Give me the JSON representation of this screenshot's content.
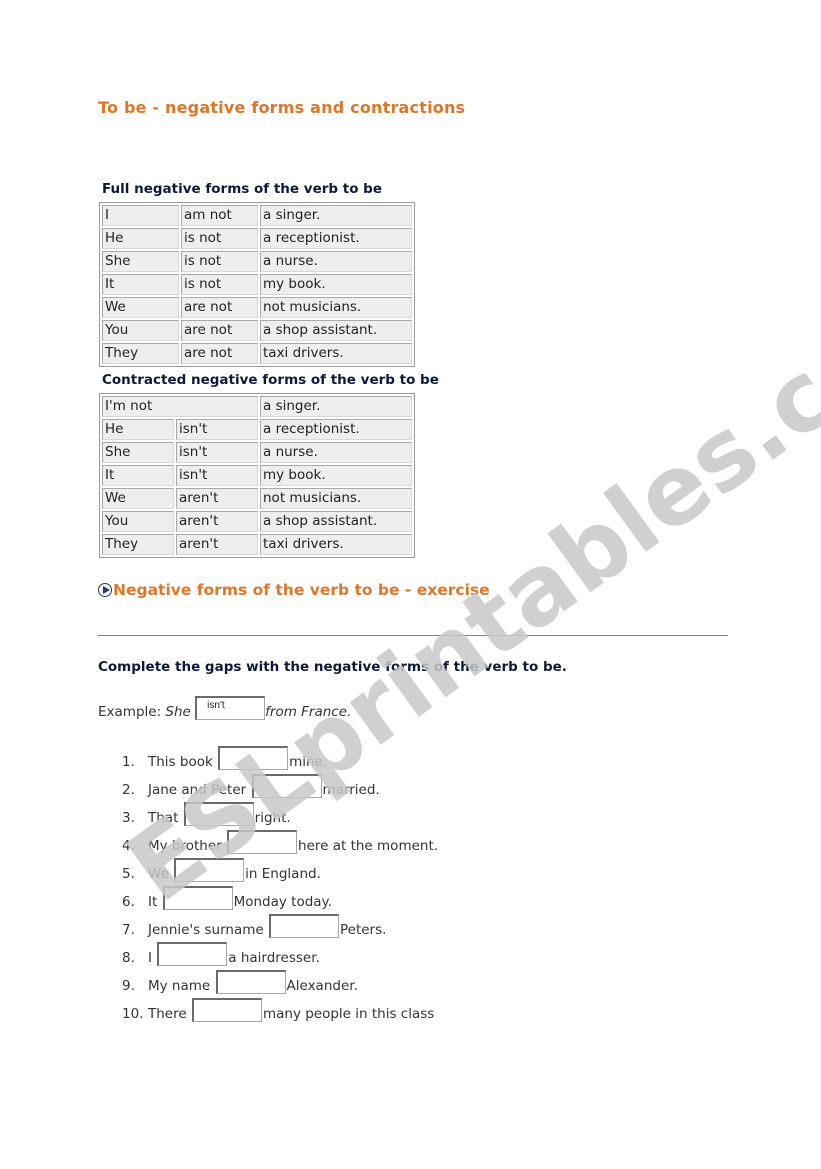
{
  "title": "To be - negative forms and contractions",
  "full_table": {
    "caption": "Full negative forms of the verb to be",
    "rows": [
      [
        "I",
        "am not",
        "a singer."
      ],
      [
        "He",
        "is not",
        "a receptionist."
      ],
      [
        "She",
        "is not",
        "a nurse."
      ],
      [
        "It",
        "is not",
        "my book."
      ],
      [
        "We",
        "are not",
        "not musicians."
      ],
      [
        "You",
        "are not",
        "a shop assistant."
      ],
      [
        "They",
        "are not",
        "taxi drivers."
      ]
    ]
  },
  "contracted_table": {
    "caption": "Contracted negative forms of the verb to be",
    "first_row": [
      "I'm not",
      "a singer."
    ],
    "rows": [
      [
        "He",
        "isn't",
        "a receptionist."
      ],
      [
        "She",
        "isn't",
        "a nurse."
      ],
      [
        "It",
        "isn't",
        "my book."
      ],
      [
        "We",
        "aren't",
        "not musicians."
      ],
      [
        "You",
        "aren't",
        "a shop assistant."
      ],
      [
        "They",
        "aren't",
        "taxi drivers."
      ]
    ]
  },
  "exercise": {
    "icon": "play-circle-icon",
    "title": "Negative forms of the verb to be - exercise",
    "instruction": "Complete the gaps with the negative forms of the verb to be.",
    "example": {
      "label": "Example:",
      "subject": "She",
      "answer": "isn't",
      "rest": "from France."
    },
    "items": [
      {
        "num": "1.",
        "before": "This book",
        "value": "",
        "after": "mine."
      },
      {
        "num": "2.",
        "before": "Jane and Peter",
        "value": "",
        "after": "married."
      },
      {
        "num": "3.",
        "before": "That",
        "value": "",
        "after": "right."
      },
      {
        "num": "4.",
        "before": "My brother",
        "value": "",
        "after": "here at the moment."
      },
      {
        "num": "5.",
        "before": "We",
        "value": "",
        "after": "in England."
      },
      {
        "num": "6.",
        "before": "It",
        "value": "",
        "after": "Monday today."
      },
      {
        "num": "7.",
        "before": "Jennie's surname",
        "value": "",
        "after": "Peters."
      },
      {
        "num": "8.",
        "before": "I",
        "value": "",
        "after": "a hairdresser."
      },
      {
        "num": "9.",
        "before": "My name",
        "value": "",
        "after": "Alexander."
      },
      {
        "num": "10.",
        "before": "There",
        "value": "",
        "after": "many people in this class"
      }
    ]
  },
  "watermark": "ESLprintables.com",
  "colors": {
    "heading": "#e0762a",
    "caption": "#12183c",
    "cell_bg": "#eeeeee",
    "watermark": "#c8c8c8"
  }
}
